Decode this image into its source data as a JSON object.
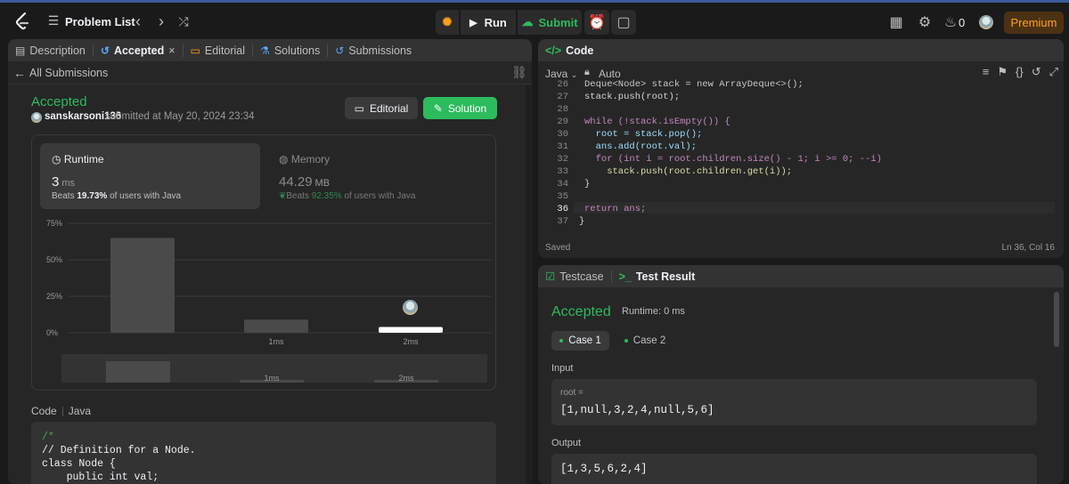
{
  "topbar": {
    "problem_list_label": "Problem List",
    "run_label": "Run",
    "submit_label": "Submit",
    "streak_count": "0",
    "premium_label": "Premium"
  },
  "left_tabs": [
    {
      "label": "Description"
    },
    {
      "label": "Accepted"
    },
    {
      "label": "Editorial"
    },
    {
      "label": "Solutions"
    },
    {
      "label": "Submissions"
    }
  ],
  "submission": {
    "back_label": "All Submissions",
    "status": "Accepted",
    "user": "sanskarsoni136",
    "submitted_text": "submitted at May 20, 2024 23:34",
    "editorial_button": "Editorial",
    "solution_button": "Solution"
  },
  "runtime": {
    "label": "Runtime",
    "value": "3",
    "unit": "ms",
    "beats_prefix": "Beats",
    "beats_value": "19.73%",
    "beats_suffix": "of users with Java"
  },
  "memory": {
    "label": "Memory",
    "value": "44.29",
    "unit": "MB",
    "beats_prefix": "Beats",
    "beats_value": "92.35%",
    "beats_suffix": "of users with Java"
  },
  "chart_data": {
    "type": "bar",
    "categories": [
      "",
      "1ms",
      "2ms"
    ],
    "values": [
      65,
      9,
      4
    ],
    "highlight_index": 2,
    "ylim": [
      0,
      75
    ],
    "yticks": [
      "75%",
      "50%",
      "25%",
      "0%"
    ],
    "xlabel": "",
    "ylabel": "",
    "mini_values": [
      25,
      3,
      3
    ],
    "mini_labels": [
      "",
      "1ms",
      "2ms"
    ],
    "colors": {
      "bar": "#4a4a4a",
      "highlight": "#ffffff",
      "grid": "#3a3a3a"
    }
  },
  "code_section": {
    "label": "Code",
    "language": "Java",
    "lines": [
      "/*",
      "// Definition for a Node.",
      "class Node {",
      "    public int val;"
    ]
  },
  "code_panel": {
    "title": "Code",
    "language": "Java",
    "mode": "Auto",
    "lines": [
      {
        "n": "26",
        "text": "Deque<Node> stack = new ArrayDeque<>();"
      },
      {
        "n": "27",
        "text": "stack.push(root);"
      },
      {
        "n": "28",
        "text": ""
      },
      {
        "n": "29",
        "text": "while (!stack.isEmpty()) {"
      },
      {
        "n": "30",
        "text": "  root = stack.pop();"
      },
      {
        "n": "31",
        "text": "  ans.add(root.val);"
      },
      {
        "n": "32",
        "text": "  for (int i = root.children.size() - 1; i >= 0; --i)"
      },
      {
        "n": "33",
        "text": "    stack.push(root.children.get(i));"
      },
      {
        "n": "34",
        "text": "}"
      },
      {
        "n": "35",
        "text": ""
      },
      {
        "n": "36",
        "text": "return ans;"
      },
      {
        "n": "37",
        "text": "}"
      }
    ],
    "saved_label": "Saved",
    "cursor_position": "Ln 36, Col 16"
  },
  "result_panel": {
    "testcase_tab": "Testcase",
    "result_tab": "Test Result",
    "status": "Accepted",
    "runtime_text": "Runtime: 0 ms",
    "cases": [
      "Case 1",
      "Case 2"
    ],
    "input_label": "Input",
    "input_var": "root =",
    "input_value": "[1,null,3,2,4,null,5,6]",
    "output_label": "Output",
    "output_value": "[1,3,5,6,2,4]"
  }
}
